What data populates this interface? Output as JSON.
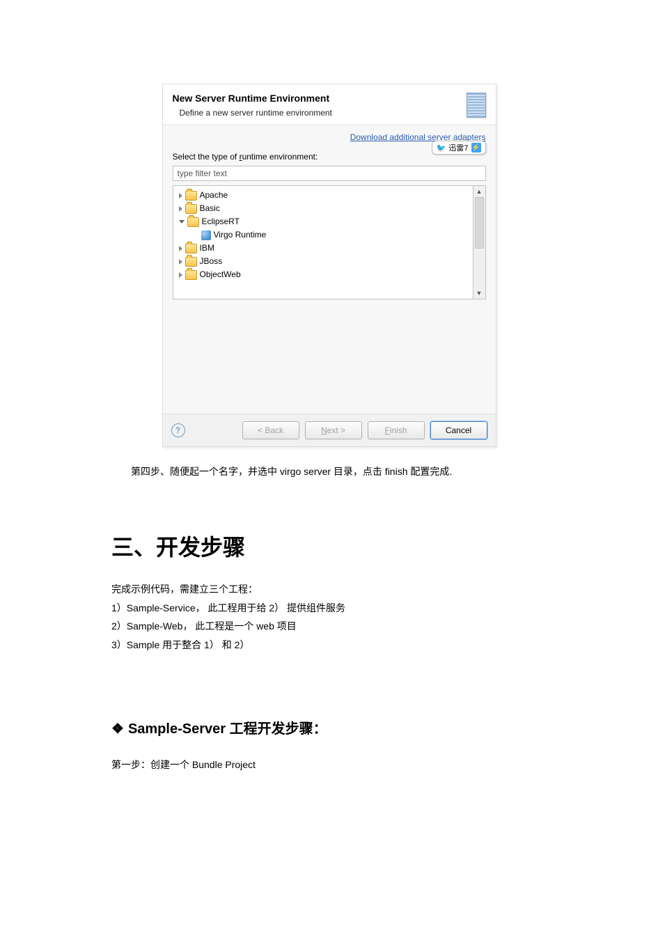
{
  "dialog": {
    "title": "New Server Runtime Environment",
    "subtitle": "Define a new server runtime environment",
    "download_link": "Download additional server adapters",
    "badge_text": "迅雷7",
    "select_label_before": "Select the type of ",
    "select_label_underline": "r",
    "select_label_after": "untime environment:",
    "filter_placeholder": "type filter text",
    "tree": {
      "apache": "Apache",
      "basic": "Basic",
      "eclipsert": "EclipseRT",
      "virgo_runtime": "Virgo Runtime",
      "ibm": "IBM",
      "jboss": "JBoss",
      "objectweb": "ObjectWeb"
    },
    "help_glyph": "?",
    "buttons": {
      "back": "< Back",
      "next_prefix": "N",
      "next_suffix": "ext >",
      "finish_prefix": "F",
      "finish_suffix": "inish",
      "cancel": "Cancel"
    }
  },
  "caption": "第四步、随便起一个名字，并选中 virgo server 目录，点击 finish 配置完成.",
  "section_heading": "三、开发步骤",
  "intro_text": "完成示例代码，需建立三个工程：",
  "list_line1": "1）Sample-Service， 此工程用于给 2） 提供组件服务",
  "list_line2": "2）Sample-Web，  此工程是一个 web 项目",
  "list_line3": "3）Sample  用于整合 1） 和 2）",
  "subsection_heading": "Sample-Server 工程开发步骤：",
  "step1_text": "第一步：创建一个 Bundle Project"
}
